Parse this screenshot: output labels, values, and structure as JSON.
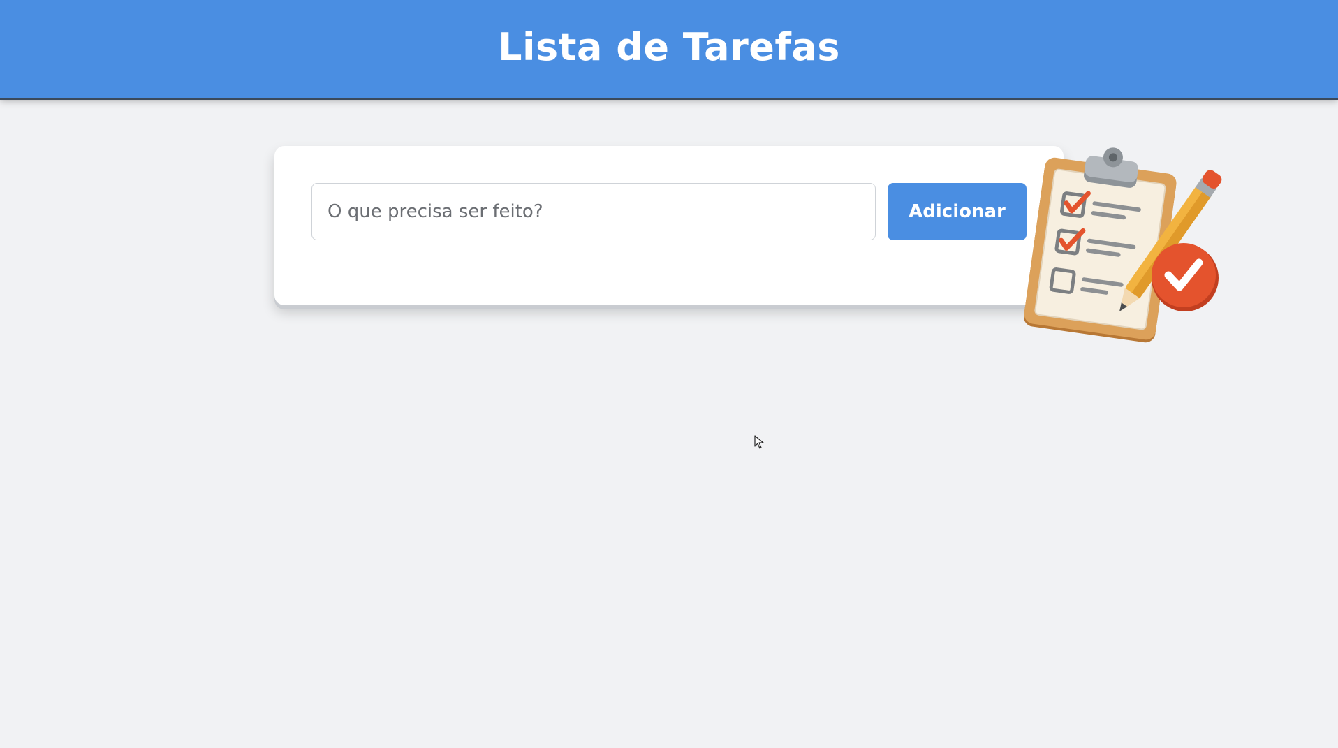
{
  "header": {
    "title": "Lista de Tarefas"
  },
  "task_form": {
    "input_placeholder": "O que precisa ser feito?",
    "input_value": "",
    "add_button_label": "Adicionar"
  },
  "illustration": {
    "icon": "clipboard-checklist-icon"
  },
  "colors": {
    "primary": "#4a8ee2",
    "background": "#f1f2f4",
    "card": "#ffffff",
    "check": "#e4532d",
    "clipboard": "#d99a4f",
    "pencil": "#f2b340"
  }
}
